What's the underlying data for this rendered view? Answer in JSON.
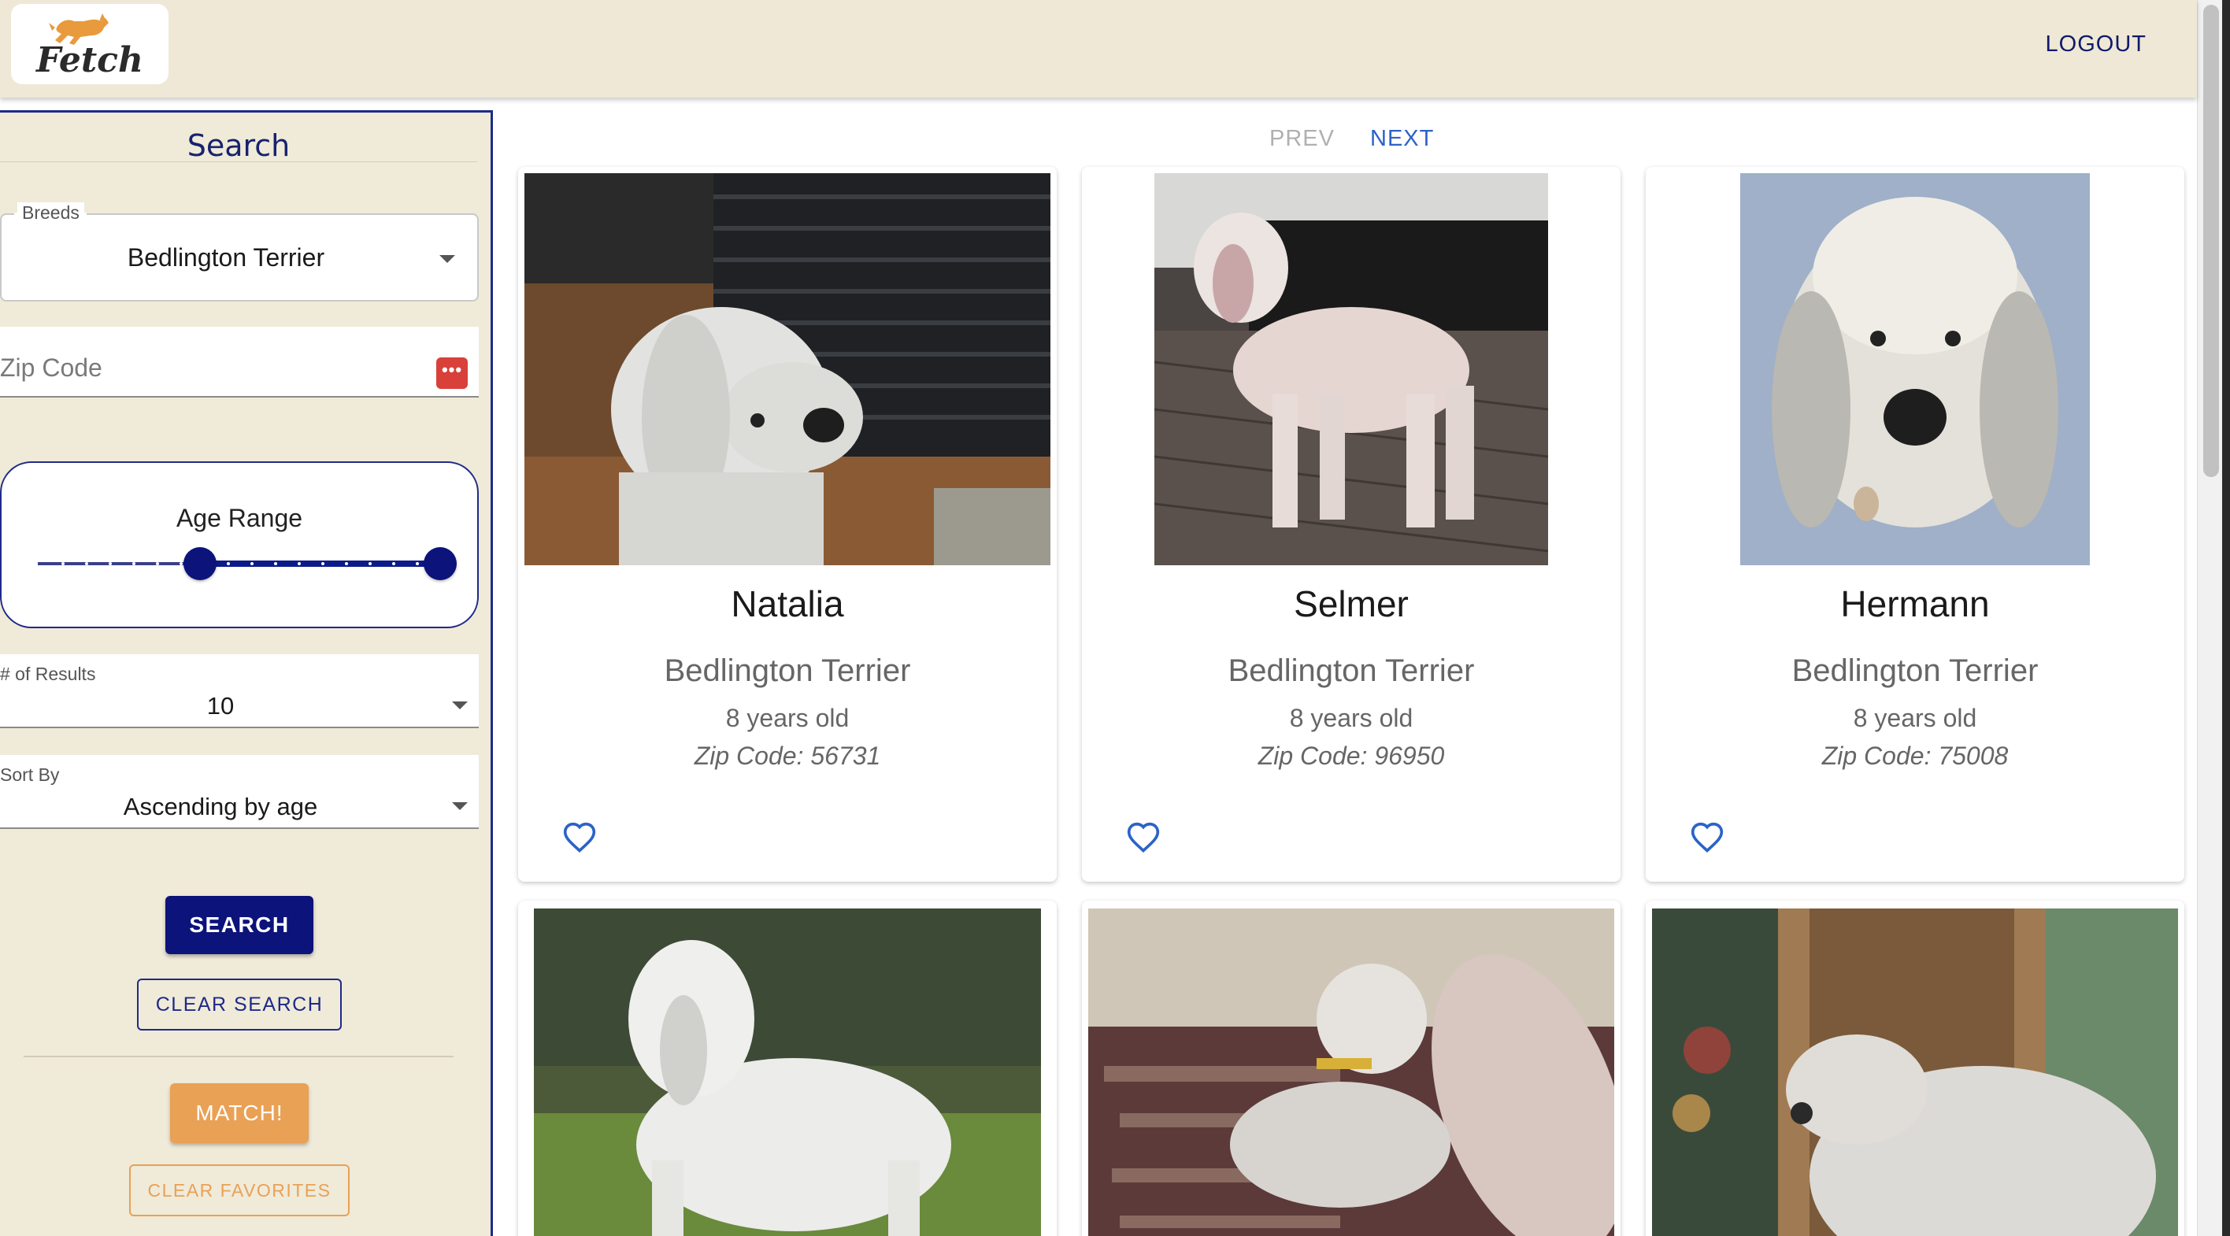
{
  "header": {
    "logo_text": "Fetch",
    "logout_label": "LOGOUT"
  },
  "sidebar": {
    "title": "Search",
    "breeds": {
      "label": "Breeds",
      "value": "Bedlington Terrier"
    },
    "zip": {
      "placeholder": "Zip Code"
    },
    "age_range": {
      "label": "Age Range"
    },
    "results": {
      "label": "# of Results",
      "value": "10"
    },
    "sort": {
      "label": "Sort By",
      "value": "Ascending by age"
    },
    "search_label": "SEARCH",
    "clear_search_label": "CLEAR SEARCH",
    "match_label": "MATCH!",
    "clear_favorites_label": "CLEAR FAVORITES"
  },
  "pager": {
    "prev": "PREV",
    "next": "NEXT"
  },
  "dogs": [
    {
      "name": "Natalia",
      "breed": "Bedlington Terrier",
      "age": "8 years old",
      "zip": "Zip Code: 56731"
    },
    {
      "name": "Selmer",
      "breed": "Bedlington Terrier",
      "age": "8 years old",
      "zip": "Zip Code: 96950"
    },
    {
      "name": "Hermann",
      "breed": "Bedlington Terrier",
      "age": "8 years old",
      "zip": "Zip Code: 75008"
    }
  ],
  "colors": {
    "header_bg": "#efe8d6",
    "primary": "#0c137a",
    "accent_orange": "#e9a155",
    "link_blue": "#2b63c8"
  },
  "icons": {
    "logo": "dog-logo-icon",
    "favorite": "heart-outline-icon",
    "dropdown": "caret-down-icon",
    "zip_helper": "password-dots-icon"
  }
}
